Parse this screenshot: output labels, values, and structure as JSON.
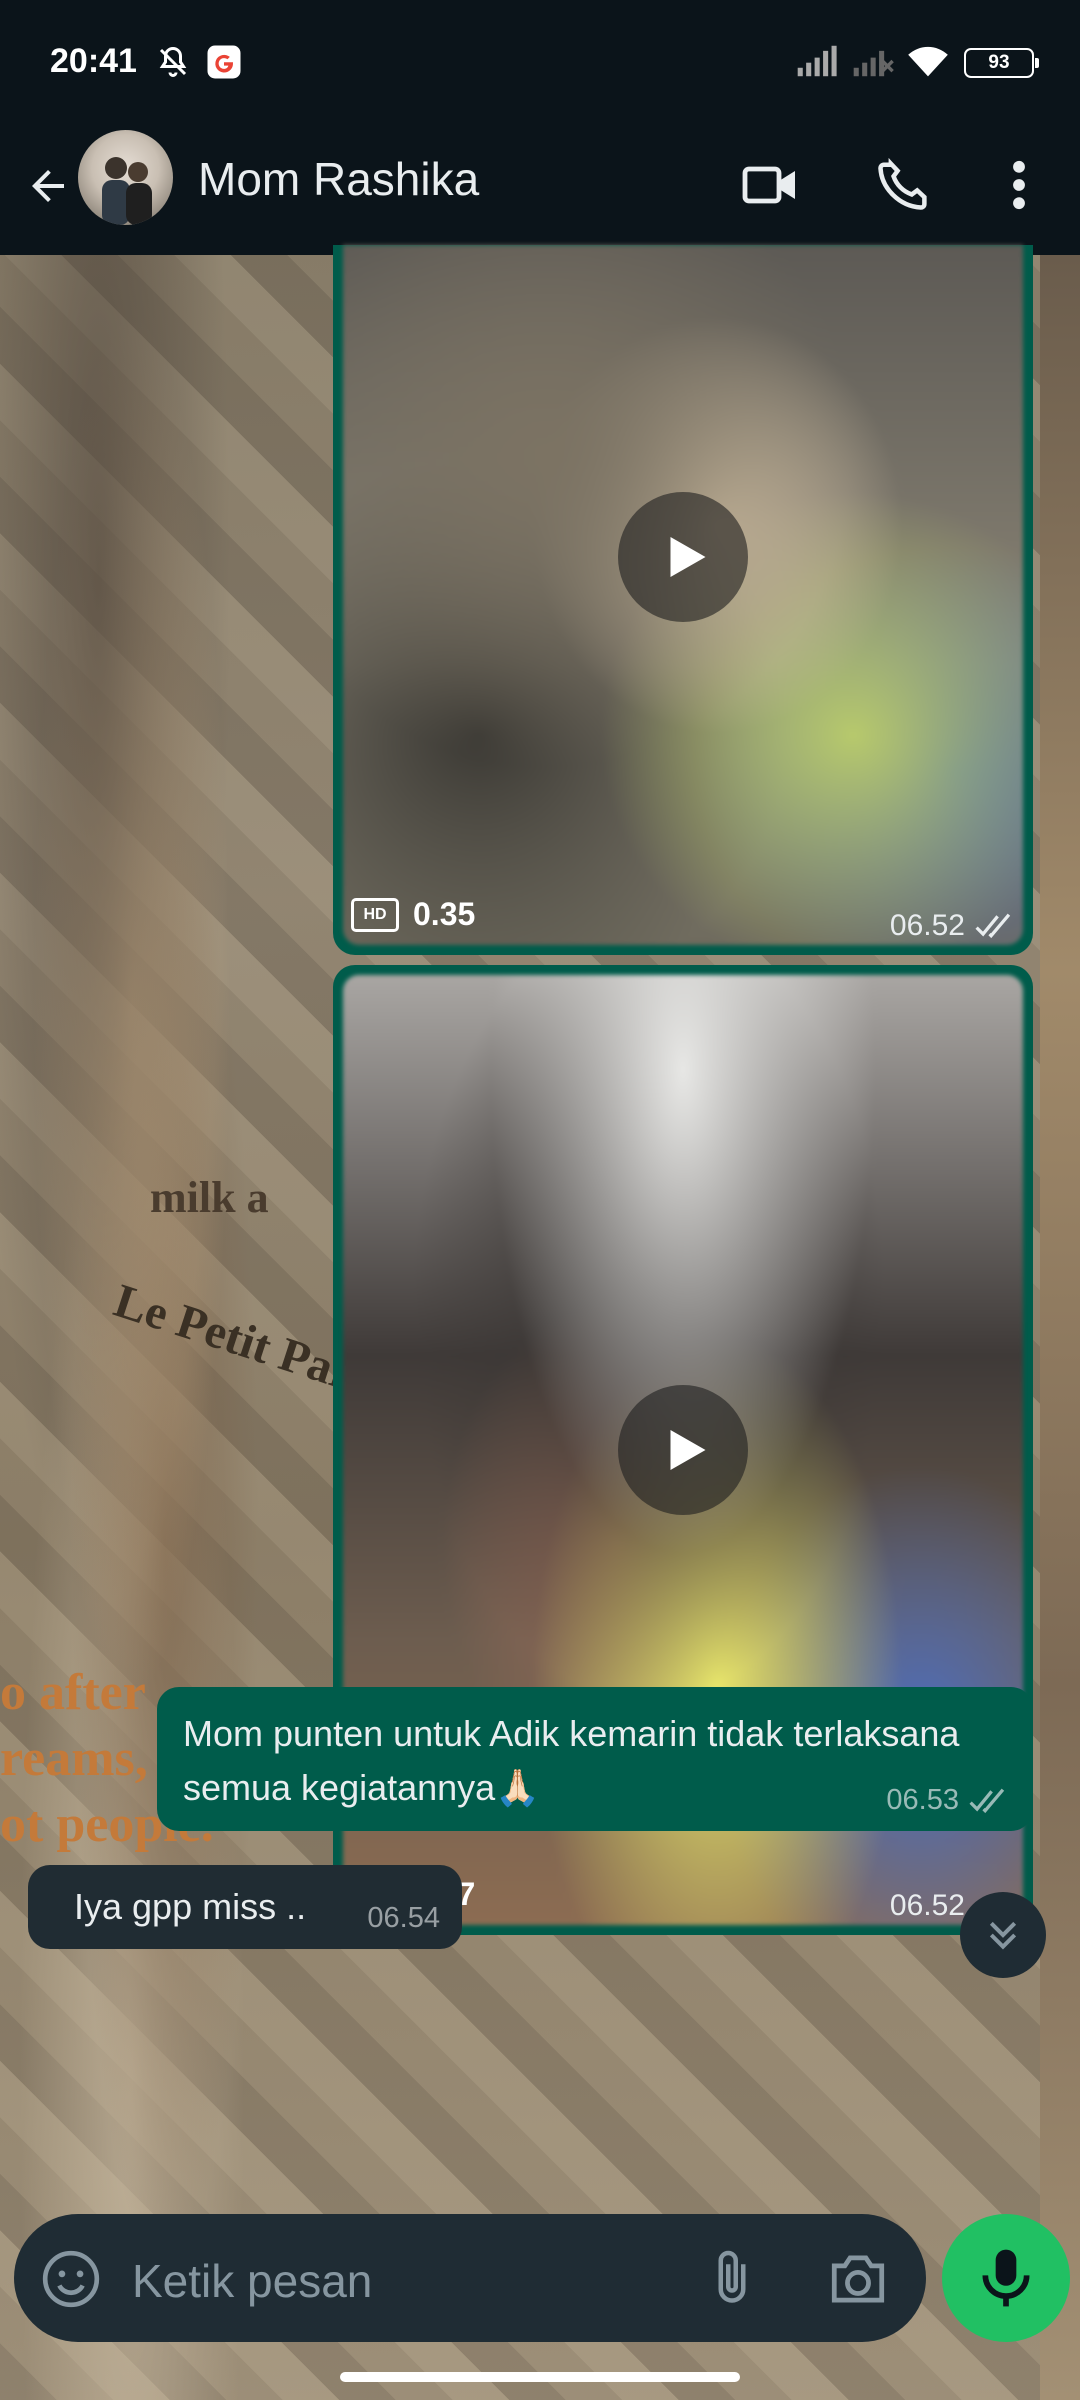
{
  "status_bar": {
    "time": "20:41",
    "battery": "93",
    "icons": [
      "mute-icon",
      "google-icon",
      "signal-icon",
      "signal-no-icon",
      "wifi-icon",
      "battery-icon"
    ]
  },
  "header": {
    "contact_name": "Mom Rashika",
    "icons": [
      "back-arrow-icon",
      "video-call-icon",
      "voice-call-icon",
      "more-options-icon"
    ]
  },
  "messages": [
    {
      "type": "video",
      "direction": "out",
      "duration": "0.35",
      "badge": "HD",
      "time": "06.52",
      "status": "read"
    },
    {
      "type": "video",
      "direction": "out",
      "duration": "0.37",
      "badge": "HD",
      "time": "06.52",
      "status": "read"
    },
    {
      "type": "text",
      "direction": "out",
      "text": "Mom punten untuk Adik kemarin tidak terlaksana semua kegiatannya🙏🏻",
      "time": "06.53",
      "status": "read"
    },
    {
      "type": "text",
      "direction": "in",
      "text": "Iya gpp miss ..",
      "time": "06.54"
    }
  ],
  "wallpaper_text": [
    "o after",
    "reams,",
    "ot people.",
    "milk a",
    "Le Petit Par"
  ],
  "composer": {
    "placeholder": "Ketik pesan"
  },
  "colors": {
    "outgoing_bubble": "#005c4b",
    "incoming_bubble": "#202c33",
    "header_bg": "#0b141a",
    "mic_button": "#21c063"
  }
}
